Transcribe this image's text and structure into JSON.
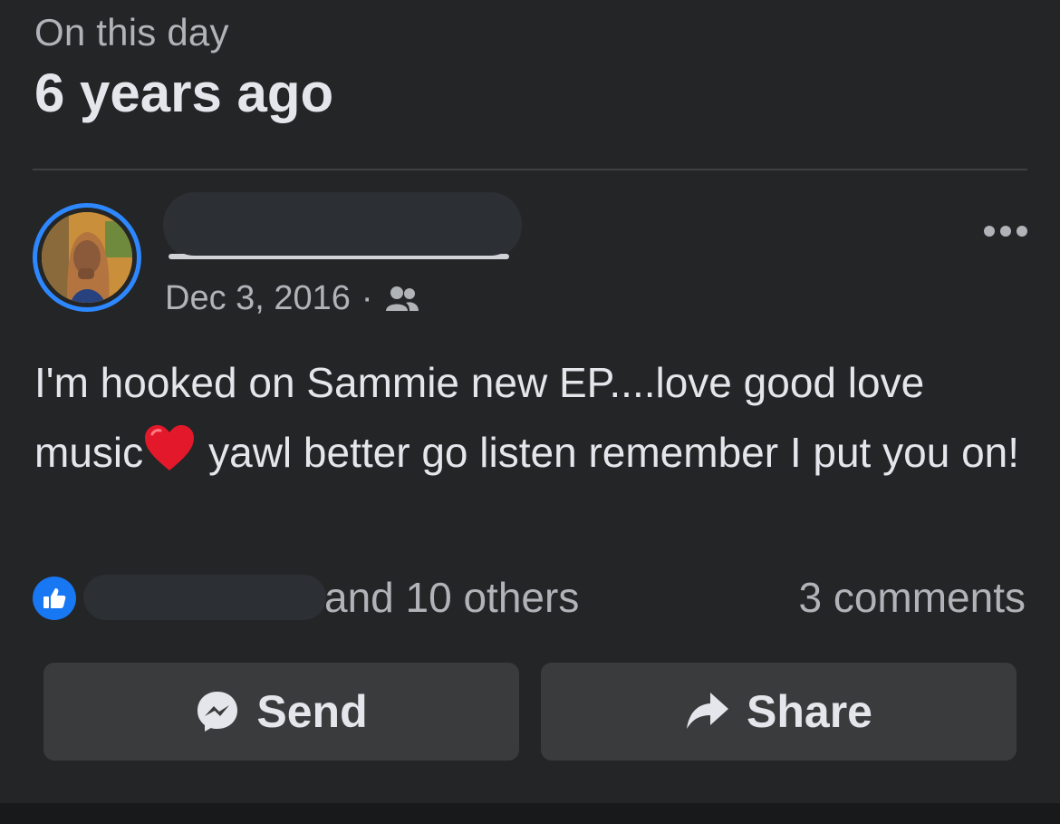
{
  "header": {
    "subtitle": "On this day",
    "title": "6 years ago"
  },
  "post": {
    "date": "Dec 3, 2016",
    "separator": "·",
    "audience_icon": "friends-icon",
    "text_part1": "I'm hooked on Sammie new EP....love good love music",
    "emoji": "❤️",
    "text_part2": "yawl better go listen remember I put you on!"
  },
  "reactions": {
    "icon": "like-icon",
    "likes_text": "and 10 others",
    "comments_text": "3 comments"
  },
  "actions": {
    "send_label": "Send",
    "send_icon": "messenger-icon",
    "share_label": "Share",
    "share_icon": "share-arrow-icon"
  },
  "colors": {
    "background": "#242526",
    "accent": "#2d88ff",
    "like_blue": "#1877f2",
    "button_bg": "#3a3b3c"
  }
}
